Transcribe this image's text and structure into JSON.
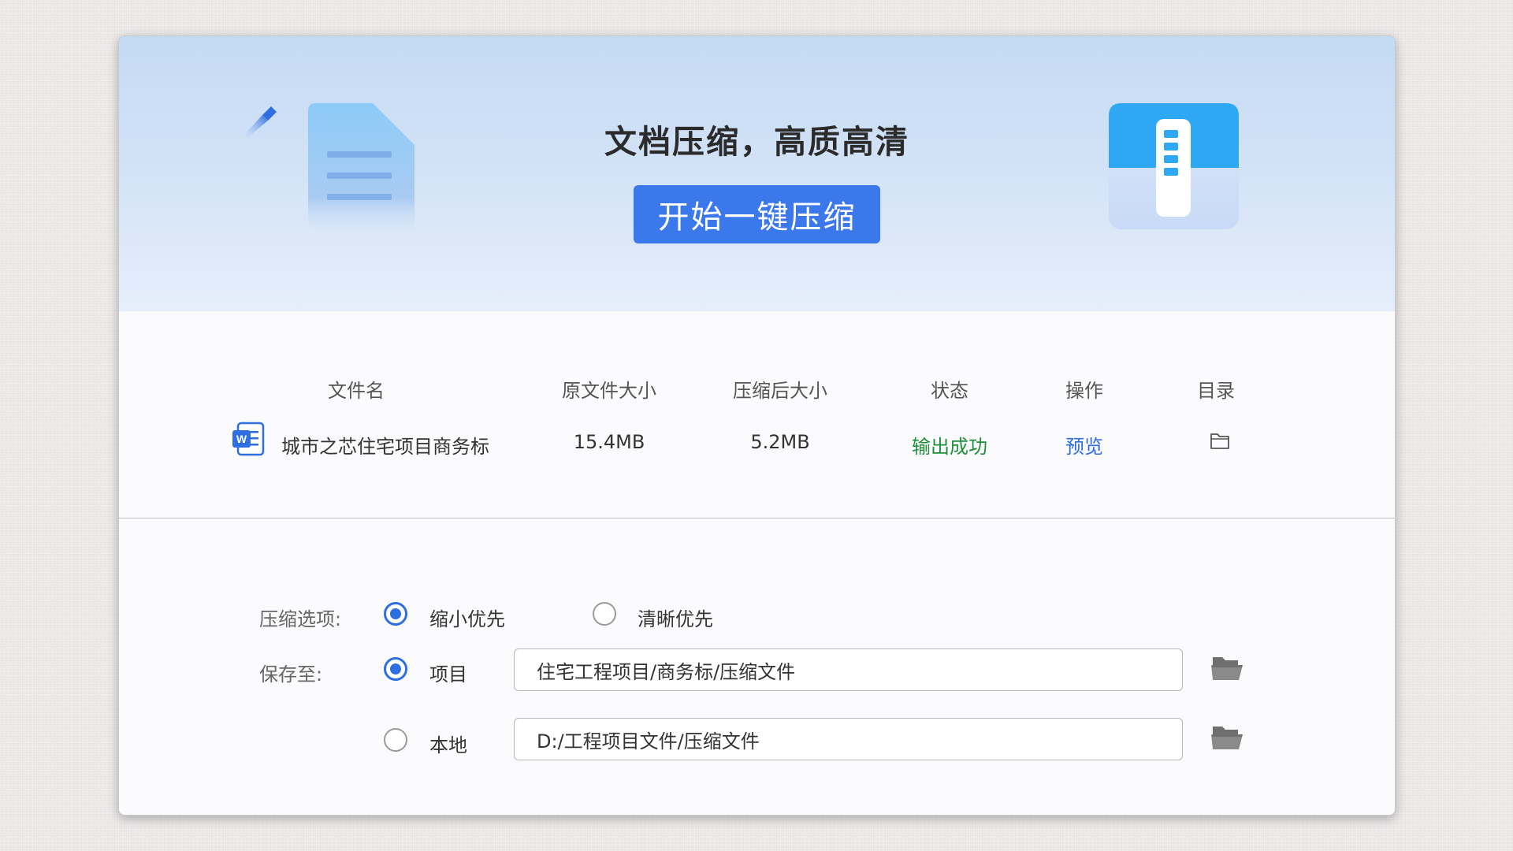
{
  "banner": {
    "title": "文档压缩，高质高清",
    "start_button": "开始一键压缩"
  },
  "table": {
    "headers": {
      "filename": "文件名",
      "original_size": "原文件大小",
      "compressed_size": "压缩后大小",
      "status": "状态",
      "action": "操作",
      "directory": "目录"
    },
    "rows": [
      {
        "file_icon": "word-document-icon",
        "filename": "城市之芯住宅项目商务标",
        "original_size": "15.4MB",
        "compressed_size": "5.2MB",
        "status": "输出成功",
        "action": "预览",
        "directory_icon": "folder-outline-icon"
      }
    ]
  },
  "options": {
    "compress_label": "压缩选项:",
    "compress_choices": [
      {
        "label": "缩小优先",
        "checked": true
      },
      {
        "label": "清晰优先",
        "checked": false
      }
    ],
    "save_label": "保存至:",
    "save_targets": [
      {
        "label": "项目",
        "checked": true,
        "path": "住宅工程项目/商务标/压缩文件"
      },
      {
        "label": "本地",
        "checked": false,
        "path": "D:/工程项目文件/压缩文件"
      }
    ],
    "browse_icon": "open-folder-icon"
  },
  "colors": {
    "accent": "#3a78ec",
    "success": "#1f8f3a",
    "link": "#2f6ee0",
    "banner_top": "#c4daf3",
    "banner_bottom": "#e6eefb"
  }
}
